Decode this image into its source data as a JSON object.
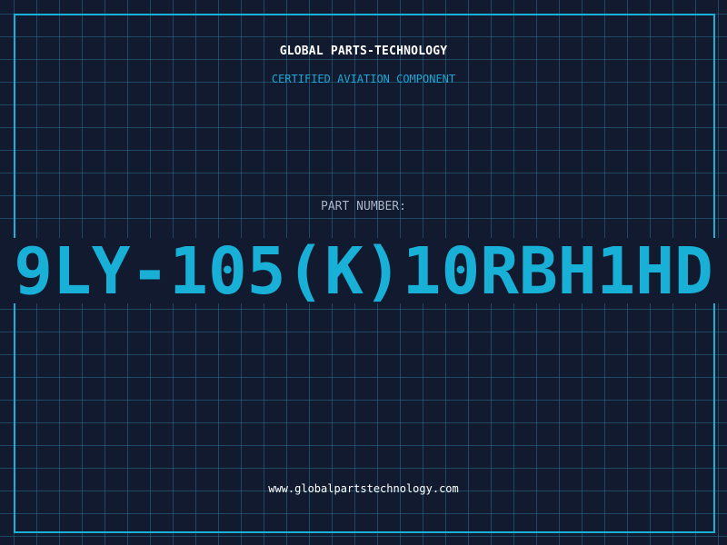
{
  "header": {
    "company_name": "GLOBAL PARTS-TECHNOLOGY",
    "tagline": "CERTIFIED AVIATION COMPONENT"
  },
  "part": {
    "label": "PART NUMBER:",
    "number": "9LY-105(K)10RBH1HD"
  },
  "footer": {
    "website": "www.globalpartstechnology.com"
  },
  "colors": {
    "background": "#111a2e",
    "accent": "#19b0d8",
    "grid": "#286e8c",
    "text_primary": "#ffffff",
    "text_muted": "#a9b4c6"
  }
}
